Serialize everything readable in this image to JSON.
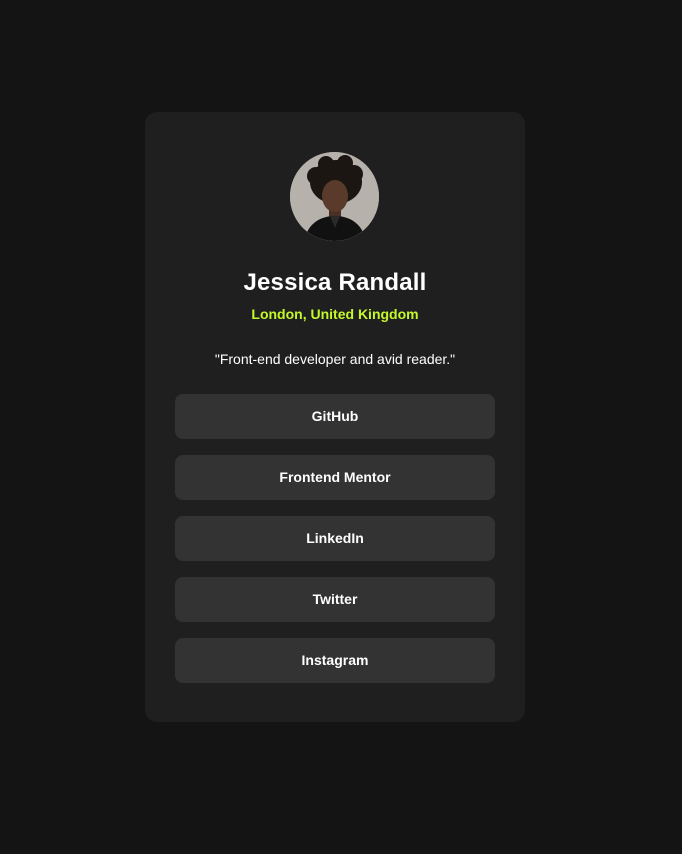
{
  "profile": {
    "name": "Jessica Randall",
    "location": "London, United Kingdom",
    "bio": "\"Front-end developer and avid reader.\"",
    "avatar_icon": "profile-photo"
  },
  "links": [
    {
      "label": "GitHub"
    },
    {
      "label": "Frontend Mentor"
    },
    {
      "label": "LinkedIn"
    },
    {
      "label": "Twitter"
    },
    {
      "label": "Instagram"
    }
  ],
  "colors": {
    "page_background": "#141414",
    "card_background": "#1f1f1f",
    "button_background": "#333333",
    "accent": "#c4f82a",
    "text": "#ffffff"
  }
}
